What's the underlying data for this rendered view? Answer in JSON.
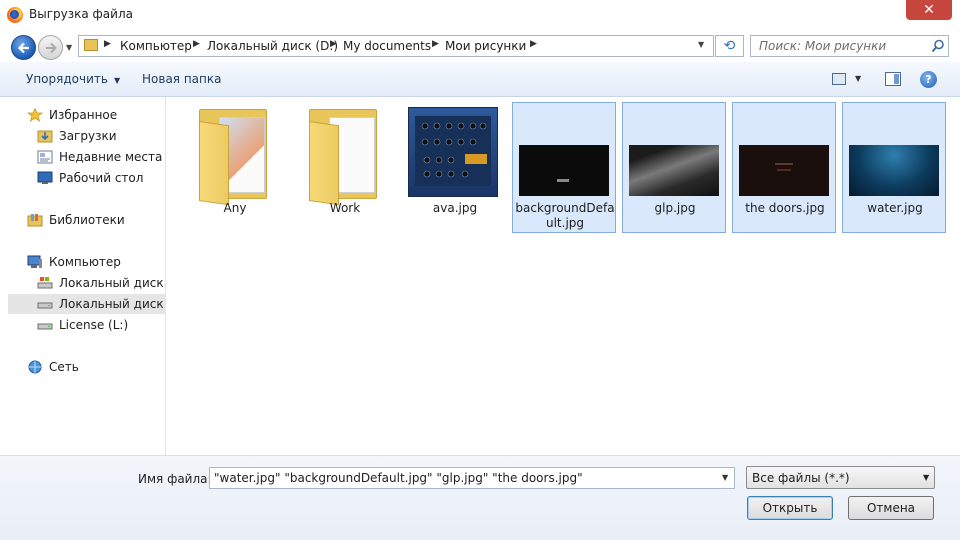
{
  "window": {
    "title": "Выгрузка файла",
    "close_label": "✕"
  },
  "address": {
    "crumbs": [
      "Компьютер",
      "Локальный диск (D:)",
      "My documents",
      "Мои рисунки"
    ],
    "search_placeholder": "Поиск: Мои рисунки"
  },
  "toolbar": {
    "organize_label": "Упорядочить",
    "new_folder_label": "Новая папка"
  },
  "sidebar": {
    "favorites": "Избранное",
    "downloads": "Загрузки",
    "recent": "Недавние места",
    "desktop": "Рабочий стол",
    "libraries": "Библиотеки",
    "computer": "Компьютер",
    "disk_c": "Локальный диск (C",
    "disk_d": "Локальный диск (D",
    "license": "License (L:)",
    "network": "Сеть"
  },
  "files": [
    {
      "name": "Any",
      "kind": "folder",
      "selected": false
    },
    {
      "name": "Work",
      "kind": "folder",
      "selected": false
    },
    {
      "name": "ava.jpg",
      "kind": "image",
      "selected": false
    },
    {
      "name": "backgroundDefault.jpg",
      "kind": "image",
      "selected": true
    },
    {
      "name": "glp.jpg",
      "kind": "image",
      "selected": true
    },
    {
      "name": "the doors.jpg",
      "kind": "image",
      "selected": true
    },
    {
      "name": "water.jpg",
      "kind": "image",
      "selected": true
    }
  ],
  "footer": {
    "filename_label": "Имя файла:",
    "filename_value": "\"water.jpg\" \"backgroundDefault.jpg\" \"glp.jpg\" \"the doors.jpg\"",
    "filetype_value": "Все файлы (*.*)",
    "open_label": "Открыть",
    "cancel_label": "Отмена"
  },
  "colors": {
    "selection_bg": "#d9e8fb",
    "selection_border": "#84acdd",
    "close_red": "#c7463d"
  }
}
